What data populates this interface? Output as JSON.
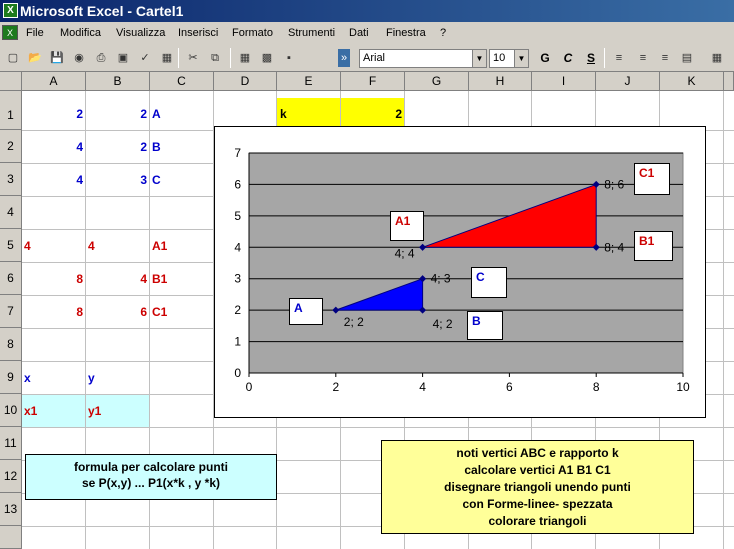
{
  "window": {
    "title": "Microsoft Excel - Cartel1"
  },
  "menu": [
    "File",
    "Modifica",
    "Visualizza",
    "Inserisci",
    "Formato",
    "Strumenti",
    "Dati",
    "Finestra",
    "?"
  ],
  "toolbar": {
    "font_name": "Arial",
    "font_size": "10",
    "bold": "G",
    "italic": "C",
    "underline": "S"
  },
  "columns": [
    "A",
    "B",
    "C",
    "D",
    "E",
    "F",
    "G",
    "H",
    "I",
    "J",
    "K"
  ],
  "rows": [
    "1",
    "2",
    "3",
    "4",
    "5",
    "6",
    "7",
    "8",
    "9",
    "10",
    "11",
    "12",
    "13"
  ],
  "cells": {
    "a1": "2",
    "b1": "2",
    "c1": "A",
    "a2": "4",
    "b2": "2",
    "c2": "B",
    "a3": "4",
    "b3": "3",
    "c3": "C",
    "a5": "4",
    "b5": "4",
    "c5": "A1",
    "a6": "8",
    "b6": "4",
    "c6": "B1",
    "a7": "8",
    "b7": "6",
    "c7": "C1",
    "a9": "x",
    "b9": "y",
    "a10": "x1",
    "b10": "y1",
    "e1": "k",
    "f1": "2"
  },
  "formula_note": {
    "line1": "formula per calcolare punti",
    "line2": "se P(x,y) ...  P1(x*k , y *k)"
  },
  "instructions_note": {
    "line1": "noti vertici ABC e rapporto k",
    "line2": "calcolare vertici A1 B1 C1",
    "line3": "disegnare triangoli unendo punti",
    "line4": "con Forme-linee- spezzata",
    "line5": "colorare triangoli"
  },
  "chart_data": {
    "type": "scatter",
    "xlim": [
      0,
      10
    ],
    "ylim": [
      0,
      7
    ],
    "x_ticks": [
      0,
      2,
      4,
      6,
      8,
      10
    ],
    "y_ticks": [
      0,
      1,
      2,
      3,
      4,
      5,
      6,
      7
    ],
    "grid": true,
    "series": [
      {
        "points": [
          [
            2,
            2
          ],
          [
            4,
            2
          ],
          [
            4,
            3
          ]
        ],
        "fill_color": "#0000ff"
      },
      {
        "points": [
          [
            4,
            4
          ],
          [
            8,
            4
          ],
          [
            8,
            6
          ]
        ],
        "fill_color": "#ff0000"
      }
    ],
    "data_labels": [
      {
        "x": 2,
        "y": 2,
        "text": "2; 2"
      },
      {
        "x": 4,
        "y": 2,
        "text": "4; 2"
      },
      {
        "x": 4,
        "y": 3,
        "text": "4; 3"
      },
      {
        "x": 4,
        "y": 4,
        "text": "4; 4"
      },
      {
        "x": 8,
        "y": 4,
        "text": "8; 4"
      },
      {
        "x": 8,
        "y": 6,
        "text": "8; 6"
      }
    ],
    "vertex_labels": [
      "A",
      "B",
      "C",
      "A1",
      "B1",
      "C1"
    ]
  },
  "colors": {
    "plot_bg": "#a6a6a6",
    "yellow": "#ffff00",
    "cyan": "#ccffff",
    "note_yellow": "#ffff99",
    "note_cyan": "#ccffff"
  }
}
